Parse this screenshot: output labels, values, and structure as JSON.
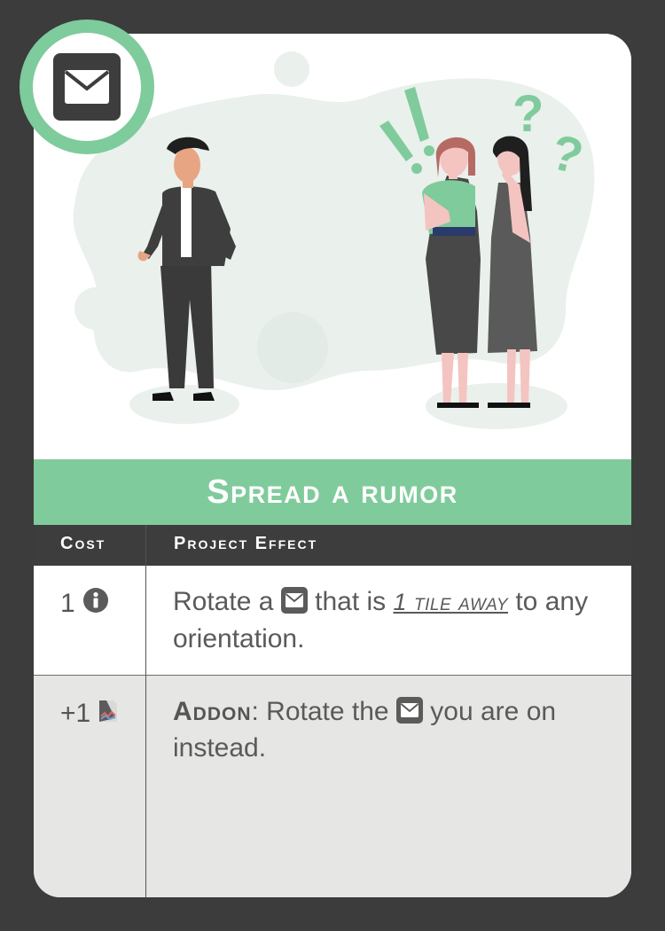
{
  "card": {
    "title": "Spread a rumor",
    "headers": {
      "cost": "Cost",
      "effect": "Project Effect"
    },
    "icon": "envelope-icon",
    "rows": [
      {
        "cost": "1",
        "cost_icon": "info-icon",
        "effect_part1": "Rotate a",
        "effect_icon": "envelope-icon",
        "effect_part2": "that is",
        "effect_keyword": "1 tile away",
        "effect_part3": "to any orientation."
      },
      {
        "cost": "+1",
        "cost_icon": "addon-card-icon",
        "keyword": "Addon",
        "effect_part1": ": Rotate the",
        "effect_icon": "envelope-icon",
        "effect_part2": "you are on instead."
      }
    ]
  },
  "colors": {
    "background": "#3c3c3c",
    "accent_green": "#80cb9c",
    "header_dark": "#3d3d3d",
    "addon_row": "#e6e6e4"
  }
}
